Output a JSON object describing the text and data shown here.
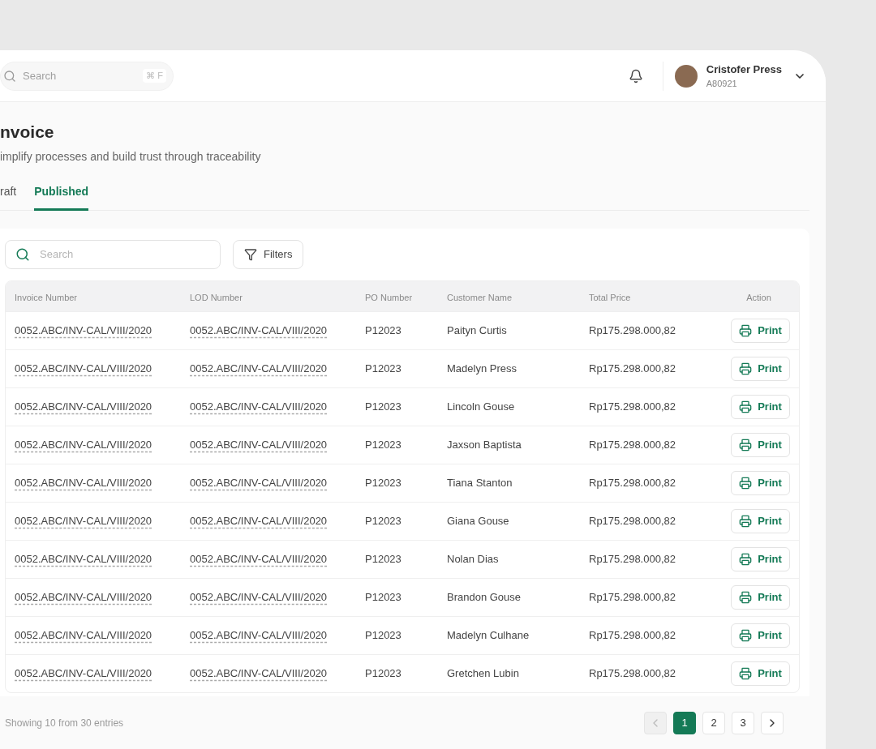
{
  "header": {
    "search": {
      "placeholder": "Search",
      "shortcut": "⌘ F"
    },
    "user": {
      "name": "Cristofer Press",
      "id": "A80921"
    }
  },
  "page": {
    "title": "nvoice",
    "subtitle": "implify processes and build trust through traceability"
  },
  "tabs": [
    {
      "label": "raft",
      "selected": false
    },
    {
      "label": "Published",
      "selected": true
    }
  ],
  "toolbar": {
    "search": {
      "placeholder": "Search"
    },
    "filters_button": "Filters"
  },
  "table": {
    "columns": [
      "Invoice Number",
      "LOD Number",
      "PO Number",
      "Customer Name",
      "Total Price",
      "Action"
    ],
    "rows": [
      {
        "invoice": "0052.ABC/INV-CAL/VIII/2020",
        "lod": "0052.ABC/INV-CAL/VIII/2020",
        "po": "P12023",
        "customer": "Paityn Curtis",
        "price": "Rp175.298.000,82",
        "action": "Print"
      },
      {
        "invoice": "0052.ABC/INV-CAL/VIII/2020",
        "lod": "0052.ABC/INV-CAL/VIII/2020",
        "po": "P12023",
        "customer": "Madelyn Press",
        "price": "Rp175.298.000,82",
        "action": "Print"
      },
      {
        "invoice": "0052.ABC/INV-CAL/VIII/2020",
        "lod": "0052.ABC/INV-CAL/VIII/2020",
        "po": "P12023",
        "customer": "Lincoln Gouse",
        "price": "Rp175.298.000,82",
        "action": "Print"
      },
      {
        "invoice": "0052.ABC/INV-CAL/VIII/2020",
        "lod": "0052.ABC/INV-CAL/VIII/2020",
        "po": "P12023",
        "customer": "Jaxson Baptista",
        "price": "Rp175.298.000,82",
        "action": "Print"
      },
      {
        "invoice": "0052.ABC/INV-CAL/VIII/2020",
        "lod": "0052.ABC/INV-CAL/VIII/2020",
        "po": "P12023",
        "customer": "Tiana Stanton",
        "price": "Rp175.298.000,82",
        "action": "Print"
      },
      {
        "invoice": "0052.ABC/INV-CAL/VIII/2020",
        "lod": "0052.ABC/INV-CAL/VIII/2020",
        "po": "P12023",
        "customer": "Giana Gouse",
        "price": "Rp175.298.000,82",
        "action": "Print"
      },
      {
        "invoice": "0052.ABC/INV-CAL/VIII/2020",
        "lod": "0052.ABC/INV-CAL/VIII/2020",
        "po": "P12023",
        "customer": "Nolan Dias",
        "price": "Rp175.298.000,82",
        "action": "Print"
      },
      {
        "invoice": "0052.ABC/INV-CAL/VIII/2020",
        "lod": "0052.ABC/INV-CAL/VIII/2020",
        "po": "P12023",
        "customer": "Brandon Gouse",
        "price": "Rp175.298.000,82",
        "action": "Print"
      },
      {
        "invoice": "0052.ABC/INV-CAL/VIII/2020",
        "lod": "0052.ABC/INV-CAL/VIII/2020",
        "po": "P12023",
        "customer": "Madelyn Culhane",
        "price": "Rp175.298.000,82",
        "action": "Print"
      },
      {
        "invoice": "0052.ABC/INV-CAL/VIII/2020",
        "lod": "0052.ABC/INV-CAL/VIII/2020",
        "po": "P12023",
        "customer": "Gretchen Lubin",
        "price": "Rp175.298.000,82",
        "action": "Print"
      }
    ]
  },
  "footer": {
    "summary": "Showing 10 from 30 entries",
    "pagination": {
      "prev_disabled": true,
      "pages": [
        {
          "label": "1",
          "selected": true
        },
        {
          "label": "2",
          "selected": false
        },
        {
          "label": "3",
          "selected": false
        }
      ],
      "next_disabled": false
    }
  }
}
